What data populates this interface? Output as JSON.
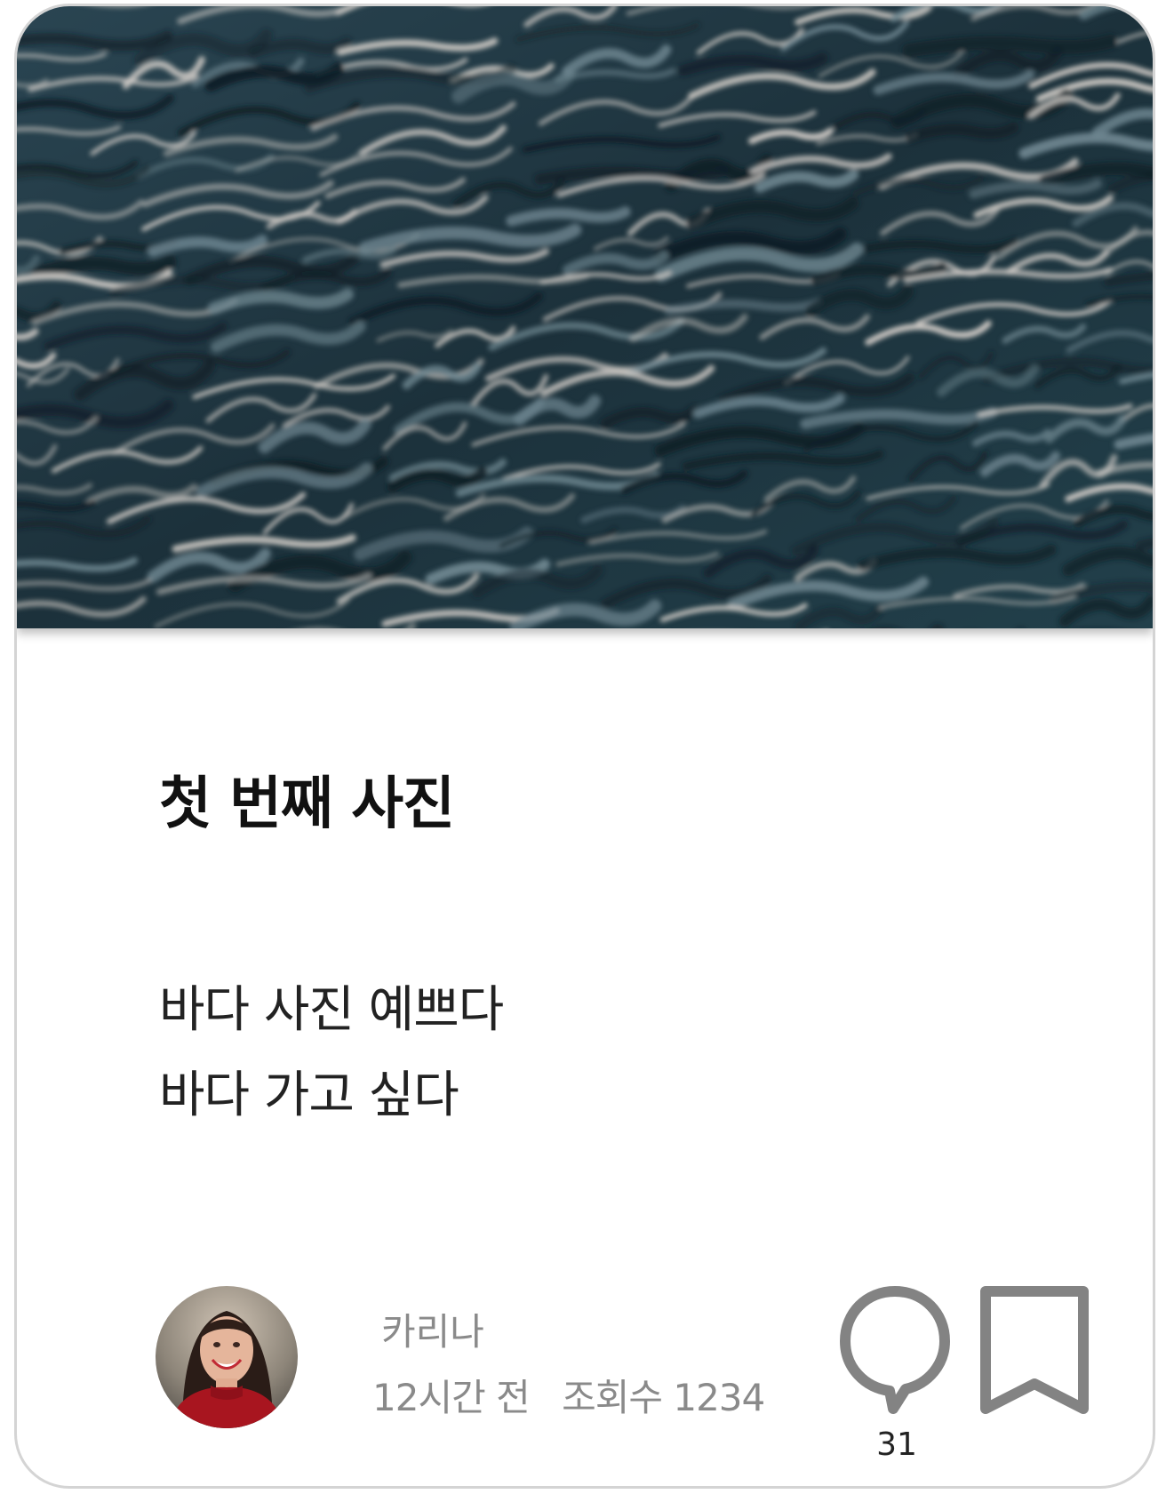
{
  "post": {
    "title": "첫 번째 사진",
    "body_lines": [
      "바다 사진 예쁘다",
      "바다 가고 싶다"
    ]
  },
  "author": {
    "name": "카리나",
    "posted_ago": "12시간 전",
    "views_label": "조회수 1234"
  },
  "actions": {
    "comment_count": "31",
    "comment_icon": "speech-bubble-icon",
    "bookmark_icon": "bookmark-icon"
  },
  "colors": {
    "icon_gray": "#838383",
    "meta_gray": "#8a8a8a",
    "card_border": "#d4d4d4",
    "sea_dark": "#1d3440",
    "sea_highlight": "#d8d2cc"
  }
}
